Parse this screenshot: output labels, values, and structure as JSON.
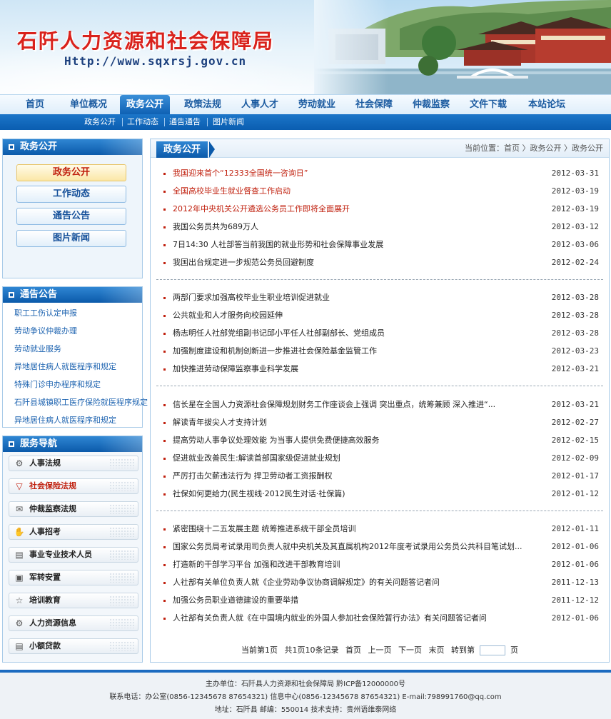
{
  "header": {
    "title": "石阡人力资源和社会保障局",
    "url": "Http://www.sqxrsj.gov.cn"
  },
  "nav": {
    "items": [
      "首页",
      "单位概况",
      "政务公开",
      "政策法规",
      "人事人才",
      "劳动就业",
      "社会保障",
      "仲裁监察",
      "文件下载",
      "本站论坛"
    ],
    "active": "政务公开"
  },
  "subnav": {
    "items": [
      "政务公开",
      "工作动态",
      "通告通告",
      "图片新闻"
    ]
  },
  "sidebar": {
    "gov_box": {
      "title": "政务公开",
      "buttons": [
        "政务公开",
        "工作动态",
        "通告公告",
        "图片新闻"
      ]
    },
    "notice_box": {
      "title": "通告公告",
      "links": [
        "职工工伤认定申报",
        "劳动争议仲裁办理",
        "劳动就业服务",
        "异地居住病人就医程序和规定",
        "特殊门诊申办程序和规定",
        "石阡县城镇职工医疗保险就医程序规定",
        "异地居住病人就医程序和规定"
      ]
    },
    "service_box": {
      "title": "服务导航",
      "items": [
        {
          "label": "人事法规",
          "icon": "gear-icon"
        },
        {
          "label": "社会保险法规",
          "icon": "funnel-icon"
        },
        {
          "label": "仲裁监察法规",
          "icon": "chat-icon"
        },
        {
          "label": "人事招考",
          "icon": "hand-icon"
        },
        {
          "label": "事业专业技术人员",
          "icon": "book-icon"
        },
        {
          "label": "军转安置",
          "icon": "id-card-icon"
        },
        {
          "label": "培训教育",
          "icon": "star-icon"
        },
        {
          "label": "人力资源信息",
          "icon": "gear-icon"
        },
        {
          "label": "小额贷款",
          "icon": "book-icon"
        }
      ]
    }
  },
  "main": {
    "tab": "政务公开",
    "breadcrumb": {
      "prefix": "当前位置：",
      "items": [
        "首页",
        "政务公开",
        "政务公开"
      ]
    },
    "groups": [
      [
        {
          "title": "我国迎来首个“12333全国统一咨询日”",
          "date": "2012-03-31",
          "hot": true
        },
        {
          "title": "全国高校毕业生就业督查工作启动",
          "date": "2012-03-19",
          "hot": true
        },
        {
          "title": "2012年中央机关公开遴选公务员工作即将全面展开",
          "date": "2012-03-19",
          "hot": true
        },
        {
          "title": "我国公务员共为689万人",
          "date": "2012-03-12",
          "hot": false
        },
        {
          "title": "7日14:30 人社部答当前我国的就业形势和社会保障事业发展",
          "date": "2012-03-06",
          "hot": false
        },
        {
          "title": "我国出台规定进一步规范公务员回避制度",
          "date": "2012-02-24",
          "hot": false
        }
      ],
      [
        {
          "title": "两部门要求加强高校毕业生职业培训促进就业",
          "date": "2012-03-28",
          "hot": false
        },
        {
          "title": "公共就业和人才服务向校园延伸",
          "date": "2012-03-28",
          "hot": false
        },
        {
          "title": "杨志明任人社部党组副书记邱小平任人社部副部长、党组成员",
          "date": "2012-03-28",
          "hot": false
        },
        {
          "title": "加强制度建设和机制创新进一步推进社会保险基金监管工作",
          "date": "2012-03-23",
          "hot": false
        },
        {
          "title": "加快推进劳动保障监察事业科学发展",
          "date": "2012-03-21",
          "hot": false
        }
      ],
      [
        {
          "title": "信长星在全国人力资源社会保障规划财务工作座谈会上强调 突出重点，统筹兼顾 深入推进“...",
          "date": "2012-03-21",
          "hot": false
        },
        {
          "title": "解读青年拔尖人才支持计划",
          "date": "2012-02-27",
          "hot": false
        },
        {
          "title": "提高劳动人事争议处理效能 为当事人提供免费便捷高效服务",
          "date": "2012-02-15",
          "hot": false
        },
        {
          "title": "促进就业改善民生:解读首部国家级促进就业规划",
          "date": "2012-02-09",
          "hot": false
        },
        {
          "title": "严厉打击欠薪违法行为 捍卫劳动者工资报酬权",
          "date": "2012-01-17",
          "hot": false
        },
        {
          "title": "社保如何更给力(民生视线·2012民生对话·社保篇)",
          "date": "2012-01-12",
          "hot": false
        }
      ],
      [
        {
          "title": "紧密围绕十二五发展主题 统筹推进系统干部全员培训",
          "date": "2012-01-11",
          "hot": false
        },
        {
          "title": "国家公务员局考试录用司负责人就中央机关及其直属机构2012年度考试录用公务员公共科目笔试划...",
          "date": "2012-01-06",
          "hot": false
        },
        {
          "title": "打造新的干部学习平台 加强和改进干部教育培训",
          "date": "2012-01-06",
          "hot": false
        },
        {
          "title": "人社部有关单位负责人就《企业劳动争议协商调解规定》的有关问题答记者问",
          "date": "2011-12-13",
          "hot": false
        },
        {
          "title": "加强公务员职业道德建设的重要举措",
          "date": "2011-12-12",
          "hot": false
        },
        {
          "title": "人社部有关负责人就《在中国境内就业的外国人参加社会保险暂行办法》有关问题答记者问",
          "date": "2012-01-06",
          "hot": false
        }
      ]
    ],
    "pager": {
      "current": "当前第1页",
      "total": "共1页10条记录",
      "first": "首页",
      "prev": "上一页",
      "next": "下一页",
      "last": "末页",
      "goto": "转到第",
      "unit": "页"
    }
  },
  "footer": {
    "line1": "主办单位：石阡县人力资源和社会保障局    黔ICP备12000000号",
    "line2": "联系电话：办公室(0856-12345678 87654321)   信息中心(0856-12345678  87654321)   E-mail:798991760@qq.com",
    "line3": "地址：石阡县   邮编：550014   技术支持：贵州语维泰网络"
  },
  "colors": {
    "brand_blue": "#0b5aaa",
    "title_red": "#d9221c",
    "hot_red": "#c0200e"
  }
}
